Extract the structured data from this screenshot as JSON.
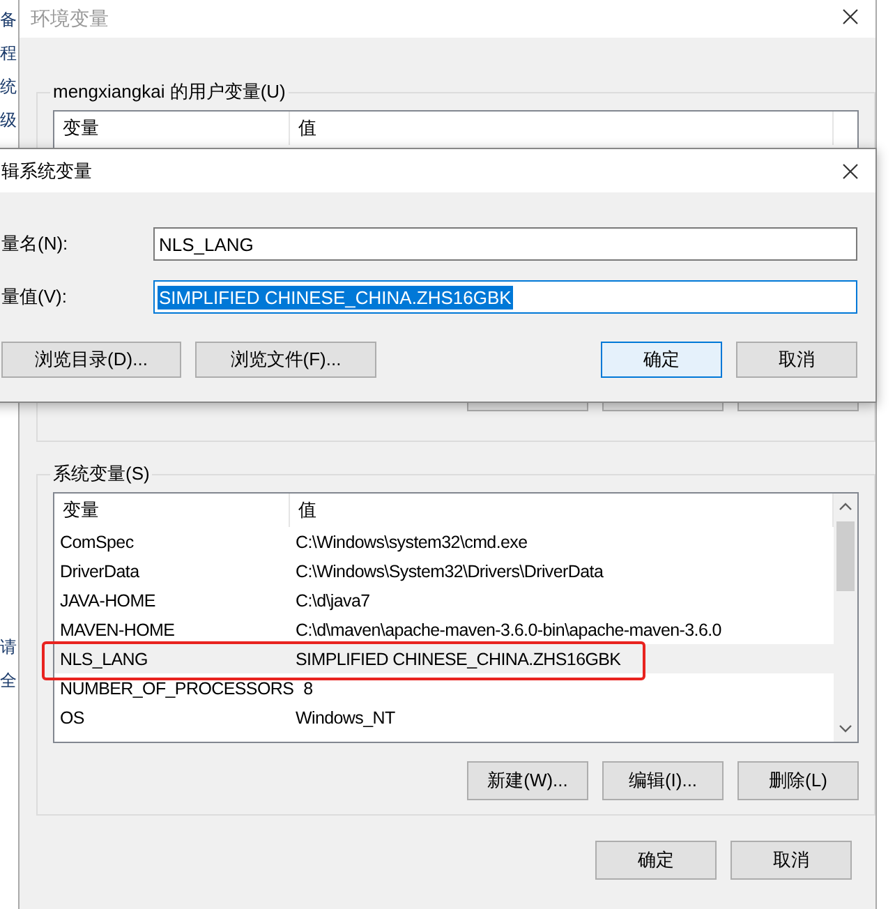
{
  "background_window": {
    "top_lines": [
      "备",
      "程",
      "统",
      "级"
    ],
    "bottom_lines": [
      "请",
      "全"
    ]
  },
  "env_dialog": {
    "title": "环境变量",
    "user_vars": {
      "label": "mengxiangkai 的用户变量(U)",
      "columns": [
        "变量",
        "值"
      ]
    },
    "system_vars": {
      "label": "系统变量(S)",
      "columns": [
        "变量",
        "值"
      ],
      "rows": [
        {
          "name": "ComSpec",
          "value": "C:\\Windows\\system32\\cmd.exe",
          "selected": false
        },
        {
          "name": "DriverData",
          "value": "C:\\Windows\\System32\\Drivers\\DriverData",
          "selected": false
        },
        {
          "name": "JAVA-HOME",
          "value": "C:\\d\\java7",
          "selected": false
        },
        {
          "name": "MAVEN-HOME",
          "value": "C:\\d\\maven\\apache-maven-3.6.0-bin\\apache-maven-3.6.0",
          "selected": false
        },
        {
          "name": "NLS_LANG",
          "value": "SIMPLIFIED CHINESE_CHINA.ZHS16GBK",
          "selected": true
        },
        {
          "name": "NUMBER_OF_PROCESSORS",
          "value": "8",
          "selected": false
        },
        {
          "name": "OS",
          "value": "Windows_NT",
          "selected": false
        }
      ]
    },
    "system_buttons": [
      "新建(W)...",
      "编辑(I)...",
      "删除(L)"
    ],
    "buttons": [
      "确定",
      "取消"
    ]
  },
  "edit_dialog": {
    "title": "辑系统变量",
    "fields": [
      {
        "label": "量名(N):",
        "value": "NLS_LANG",
        "focused": false
      },
      {
        "label": "量值(V):",
        "value": "SIMPLIFIED CHINESE_CHINA.ZHS16GBK",
        "focused": true
      }
    ],
    "buttons": [
      {
        "label": "浏览目录(D)...",
        "default": false
      },
      {
        "label": "浏览文件(F)...",
        "default": false
      },
      {
        "label": "确定",
        "default": true
      },
      {
        "label": "取消",
        "default": false
      }
    ]
  }
}
